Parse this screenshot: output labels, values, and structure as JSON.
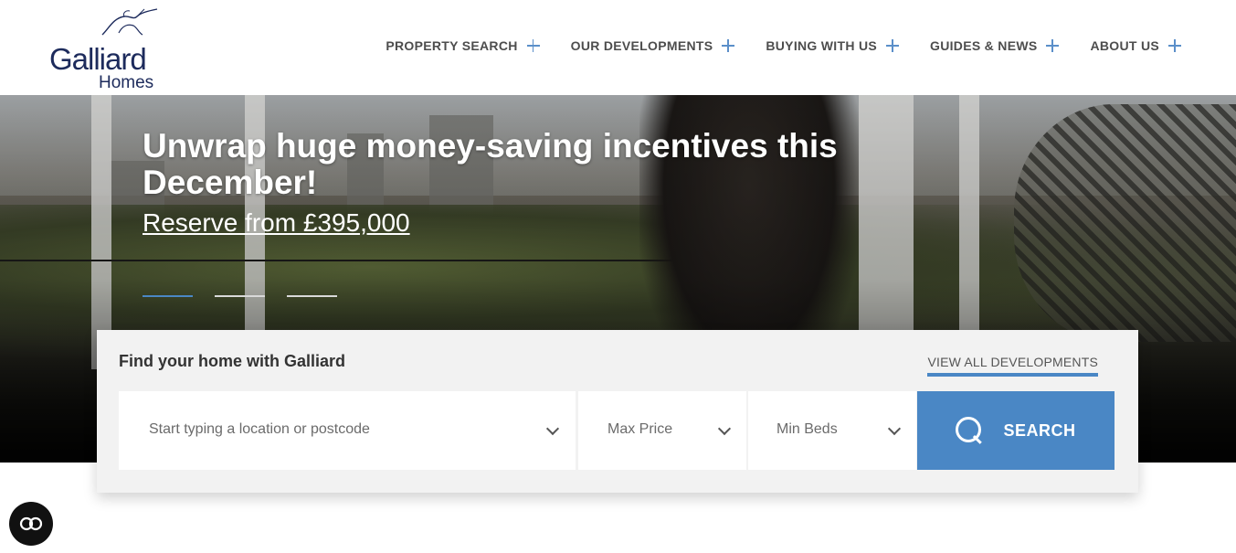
{
  "brand": {
    "name": "Galliard",
    "sub": "Homes",
    "color": "#1d2b5c"
  },
  "nav": {
    "items": [
      {
        "label": "PROPERTY SEARCH",
        "icon": "plus-icon"
      },
      {
        "label": "OUR DEVELOPMENTS",
        "icon": "plus-icon"
      },
      {
        "label": "BUYING WITH US",
        "icon": "plus-icon"
      },
      {
        "label": "GUIDES & NEWS",
        "icon": "plus-icon"
      },
      {
        "label": "ABOUT US",
        "icon": "plus-icon"
      }
    ]
  },
  "hero": {
    "title": "Unwrap huge money-saving incentives this December!",
    "link": "Reserve from £395,000",
    "slides": {
      "count": 3,
      "active": 1
    }
  },
  "search": {
    "title": "Find your home with Galliard",
    "view_all": "VIEW ALL DEVELOPMENTS",
    "location_placeholder": "Start typing a location or postcode",
    "max_price": "Max Price",
    "min_beds": "Min Beds",
    "button": "SEARCH"
  },
  "colors": {
    "accent": "#4a87c5",
    "nav_text": "#4d4d4d",
    "panel_bg": "#f2f2f2"
  },
  "accessibility": {
    "icon": "accessibility-icon"
  }
}
